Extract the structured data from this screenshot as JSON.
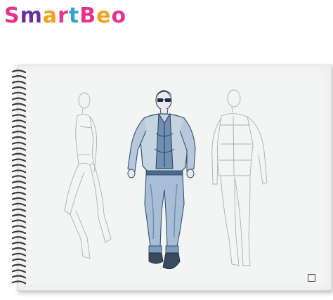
{
  "logo": {
    "letters": [
      {
        "char": "S",
        "color": "#e8308a"
      },
      {
        "char": "m",
        "color": "#6a2fa8"
      },
      {
        "char": "a",
        "color": "#f4a11d"
      },
      {
        "char": "r",
        "color": "#e8308a"
      },
      {
        "char": "t",
        "color": "#2fa3d6"
      },
      {
        "char": "B",
        "color": "#e8308a"
      },
      {
        "char": "e",
        "color": "#f4a11d"
      },
      {
        "char": "o",
        "color": "#e8308a"
      }
    ]
  },
  "colors": {
    "paper": "#f3f4f4",
    "sketch_line": "#9ea6ae",
    "ink_blue": "#3e6c9a",
    "spiral": "#3a3a3a"
  }
}
